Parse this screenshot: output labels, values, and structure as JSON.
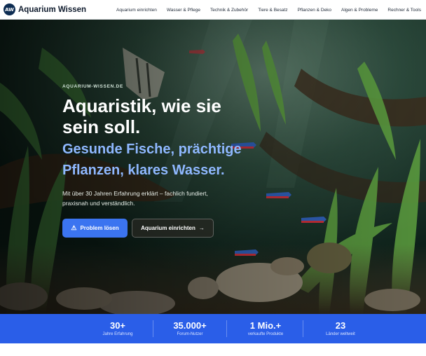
{
  "brand": {
    "logo_text": "AW",
    "name": "Aquarium Wissen"
  },
  "nav": {
    "items": [
      {
        "label": "Aquarium einrichten"
      },
      {
        "label": "Wasser & Pflege"
      },
      {
        "label": "Technik & Zubehör"
      },
      {
        "label": "Tiere & Besatz"
      },
      {
        "label": "Pflanzen & Deko"
      },
      {
        "label": "Algen & Probleme"
      },
      {
        "label": "Rechner & Tools"
      }
    ]
  },
  "hero": {
    "eyebrow": "AQUARIUM-WISSEN.DE",
    "headline_1": "Aquaristik, wie sie",
    "headline_2": "sein soll.",
    "subhead_1": "Gesunde Fische, prächtige",
    "subhead_2": "Pflanzen, klares Wasser.",
    "intro": "Mit über 30 Jahren Erfahrung erklärt – fachlich fundiert, praxisnah und verständlich.",
    "primary_button": {
      "label": "Problem lösen",
      "icon": "warning-icon"
    },
    "secondary_button": {
      "label": "Aquarium einrichten",
      "icon": "arrow-right-icon"
    }
  },
  "stats": [
    {
      "value": "30+",
      "label": "Jahre Erfahrung"
    },
    {
      "value": "35.000+",
      "label": "Forum-Nutzer"
    },
    {
      "value": "1 Mio.+",
      "label": "verkaufte Produkte"
    },
    {
      "value": "23",
      "label": "Länder weltweit"
    }
  ],
  "colors": {
    "accent": "#3b74f0",
    "stats_band": "#2a5ee8",
    "subhead": "#8fb8ff",
    "brand_dark": "#0d2c52"
  }
}
